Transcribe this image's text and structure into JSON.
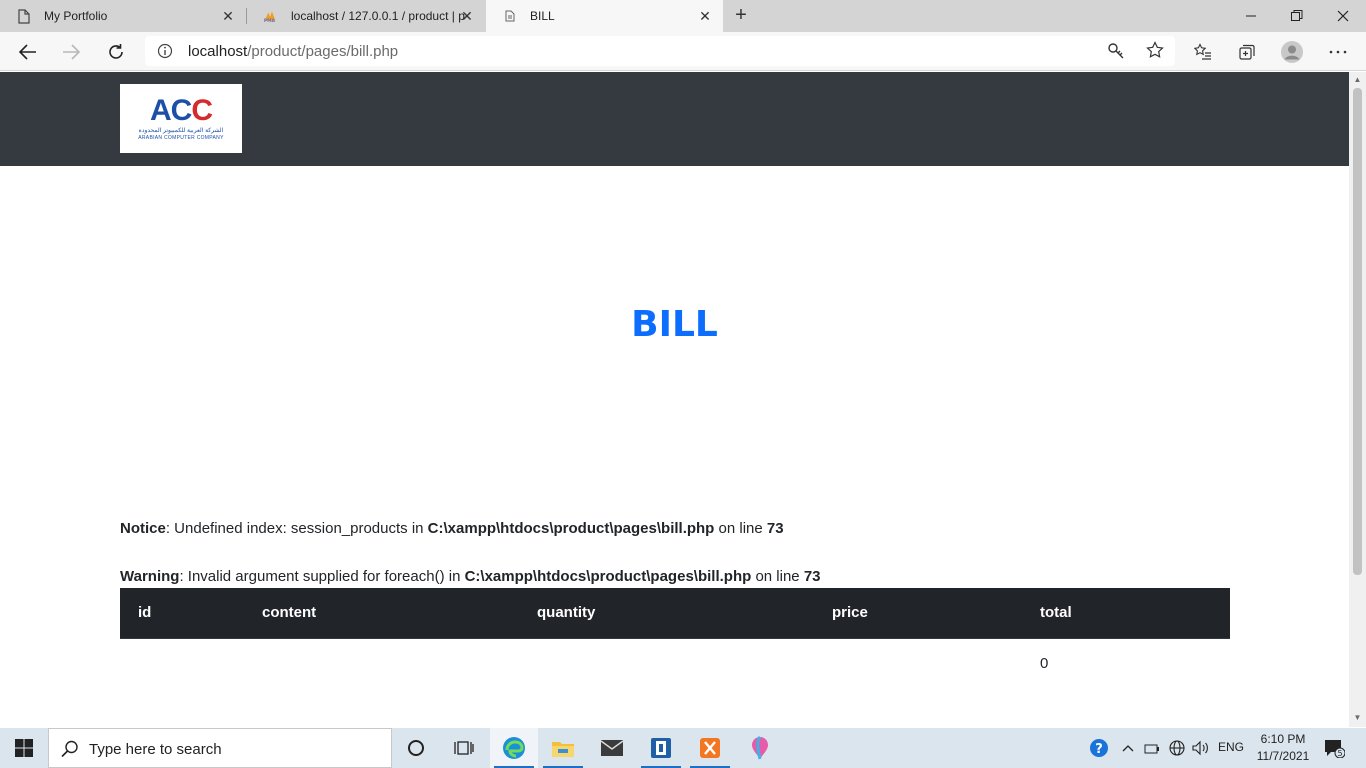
{
  "browser": {
    "tabs": [
      {
        "title": "My Portfolio",
        "icon": "page-icon",
        "active": false
      },
      {
        "title": "localhost / 127.0.0.1 / product | p",
        "icon": "phpmyadmin-icon",
        "active": false
      },
      {
        "title": "BILL",
        "icon": "page-icon",
        "active": true
      }
    ],
    "url_host": "localhost",
    "url_path": "/product/pages/bill.php"
  },
  "page": {
    "logo": {
      "main": "ACC",
      "arabic": "الشركة العربية للكمبيوتر المحدودة",
      "sub": "ARABIAN COMPUTER COMPANY"
    },
    "title": "BILL",
    "notice": {
      "label": "Notice",
      "text": ": Undefined index: session_products in ",
      "file": "C:\\xampp\\htdocs\\product\\pages\\bill.php",
      "on_line": " on line ",
      "line": "73"
    },
    "warning": {
      "label": "Warning",
      "text": ": Invalid argument supplied for foreach() in ",
      "file": "C:\\xampp\\htdocs\\product\\pages\\bill.php",
      "on_line": " on line ",
      "line": "73"
    },
    "table": {
      "headers": [
        "id",
        "content",
        "quantity",
        "price",
        "total"
      ],
      "total_value": "0"
    }
  },
  "taskbar": {
    "search_placeholder": "Type here to search",
    "language": "ENG",
    "time": "6:10 PM",
    "date": "11/7/2021",
    "notification_count": "5"
  }
}
